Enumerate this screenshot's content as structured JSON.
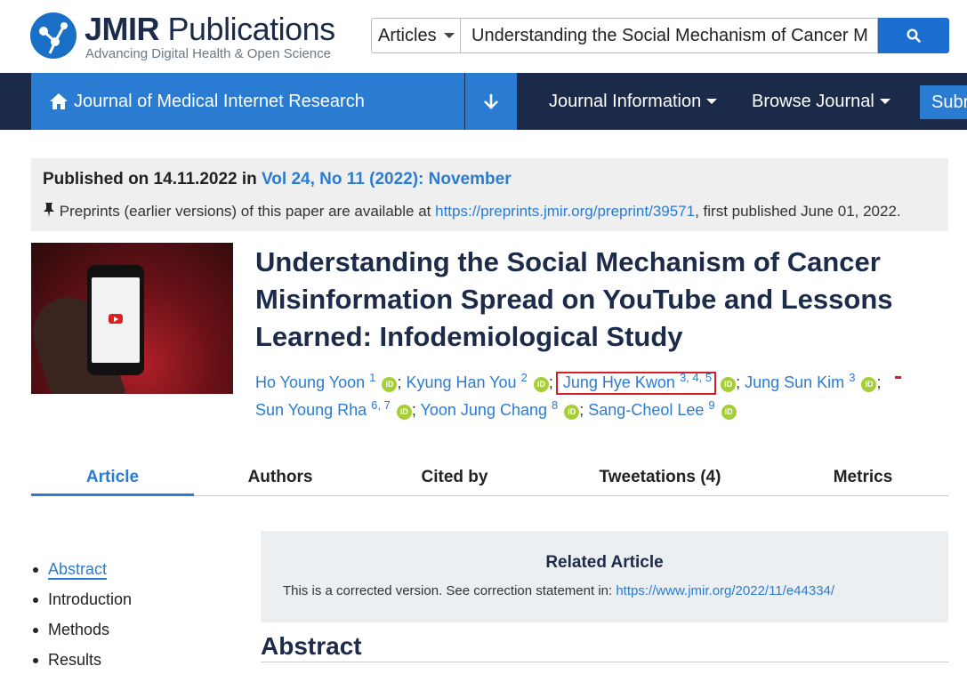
{
  "header": {
    "logo_bold": "JMIR",
    "logo_rest": " Publications",
    "tagline": "Advancing Digital Health & Open Science",
    "search": {
      "scope": "Articles",
      "value": "Understanding the Social Mechanism of Cancer M"
    }
  },
  "nav": {
    "journal": "Journal of Medical Internet Research",
    "items": [
      "Journal Information",
      "Browse Journal"
    ],
    "submit": "Subm"
  },
  "published": {
    "prefix": "Published on 14.11.2022 in",
    "issue": "Vol 24, No 11 (2022): November",
    "preprint_prefix": "Preprints (earlier versions) of this paper are available at",
    "preprint_url": "https://preprints.jmir.org/preprint/39571",
    "preprint_suffix": ", first published June 01, 2022."
  },
  "article": {
    "title": "Understanding the Social Mechanism of Cancer Misinformation Spread on YouTube and Lessons Learned: Infodemiological Study",
    "orcid_label": "iD",
    "authors": [
      {
        "name": "Ho Young Yoon",
        "aff": "1"
      },
      {
        "name": "Kyung Han You",
        "aff": "2"
      },
      {
        "name": "Jung Hye Kwon",
        "aff": "3, 4, 5"
      },
      {
        "name": "Jung Sun Kim",
        "aff": "3"
      },
      {
        "name": "Sun Young Rha",
        "aff": "6, 7"
      },
      {
        "name": "Yoon Jung Chang",
        "aff": "8"
      },
      {
        "name": "Sang-Cheol Lee",
        "aff": "9"
      }
    ]
  },
  "tabs": [
    "Article",
    "Authors",
    "Cited by",
    "Tweetations (4)",
    "Metrics"
  ],
  "toc": [
    "Abstract",
    "Introduction",
    "Methods",
    "Results"
  ],
  "related": {
    "title": "Related Article",
    "text": "This is a corrected version. See correction statement in:",
    "url": "https://www.jmir.org/2022/11/e44334/"
  },
  "abstract_heading": "Abstract",
  "colors": {
    "accent": "#2a7cd3",
    "navy": "#1c2a4a",
    "highlight": "#d32027",
    "orcid": "#a6ce39"
  }
}
